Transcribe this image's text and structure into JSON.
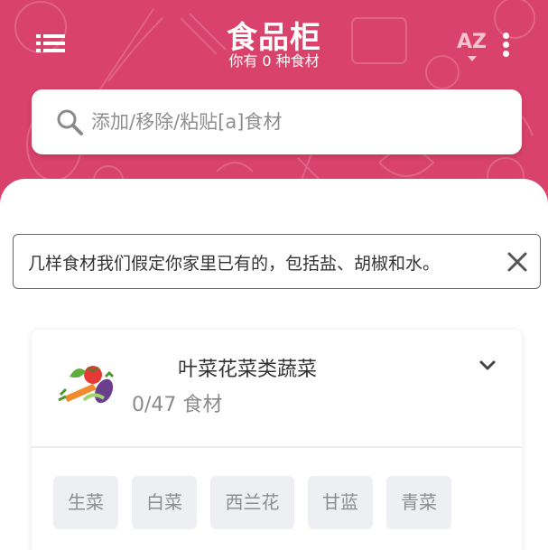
{
  "header": {
    "title": "食品柜",
    "subtitle": "你有 0 种食材",
    "sort_label": "AZ"
  },
  "search": {
    "placeholder": "添加/移除/粘贴[a]食材",
    "value": ""
  },
  "notice": {
    "text": "几样食材我们假定你家里已有的，包括盐、胡椒和水。"
  },
  "category": {
    "title": "叶菜花菜类蔬菜",
    "count": "0/47 食材",
    "chips": [
      "生菜",
      "白菜",
      "西兰花",
      "甘蓝",
      "青菜"
    ]
  },
  "colors": {
    "accent": "#d9426a",
    "chip_bg": "#eeeff3"
  },
  "icons": [
    "menu-icon",
    "sort-az-icon",
    "more-vert-icon",
    "search-icon",
    "close-icon",
    "vegetables-icon",
    "chevron-down-icon"
  ]
}
